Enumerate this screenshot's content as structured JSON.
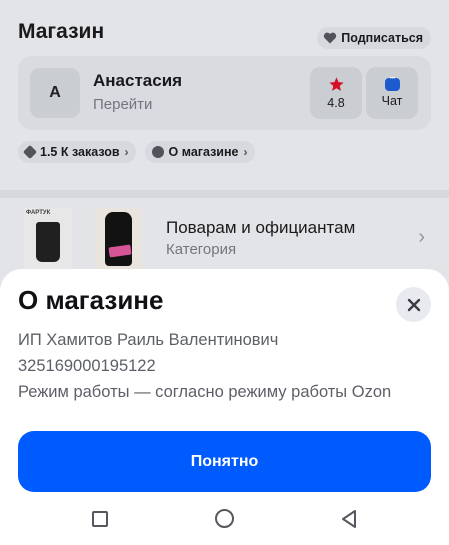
{
  "store": {
    "title": "Магазин",
    "subscribe_label": "Подписаться",
    "seller": {
      "avatar_letter": "А",
      "name": "Анастасия",
      "link_label": "Перейти",
      "rating": "4.8",
      "chat_label": "Чат"
    },
    "chips": [
      {
        "label": "1.5 К заказов",
        "icon": "box-icon"
      },
      {
        "label": "О магазине",
        "icon": "info-icon"
      }
    ]
  },
  "category": {
    "thumb1_label": "ФАРТУК",
    "title": "Поварам и официантам",
    "subtitle": "Категория"
  },
  "sheet": {
    "title": "О магазине",
    "lines": [
      "ИП Хамитов Раиль Валентинович",
      "325169000195122",
      "Режим работы — согласно режиму работы Ozon"
    ],
    "ok_label": "Понятно"
  },
  "colors": {
    "accent": "#005bff",
    "rating_star": "#e0102b",
    "chat": "#1f5fd8"
  },
  "icons": [
    "heart-icon",
    "star-icon",
    "chat-icon",
    "box-icon",
    "info-icon",
    "chevron-right-icon",
    "close-icon",
    "nav-recent-icon",
    "nav-home-icon",
    "nav-back-icon"
  ]
}
